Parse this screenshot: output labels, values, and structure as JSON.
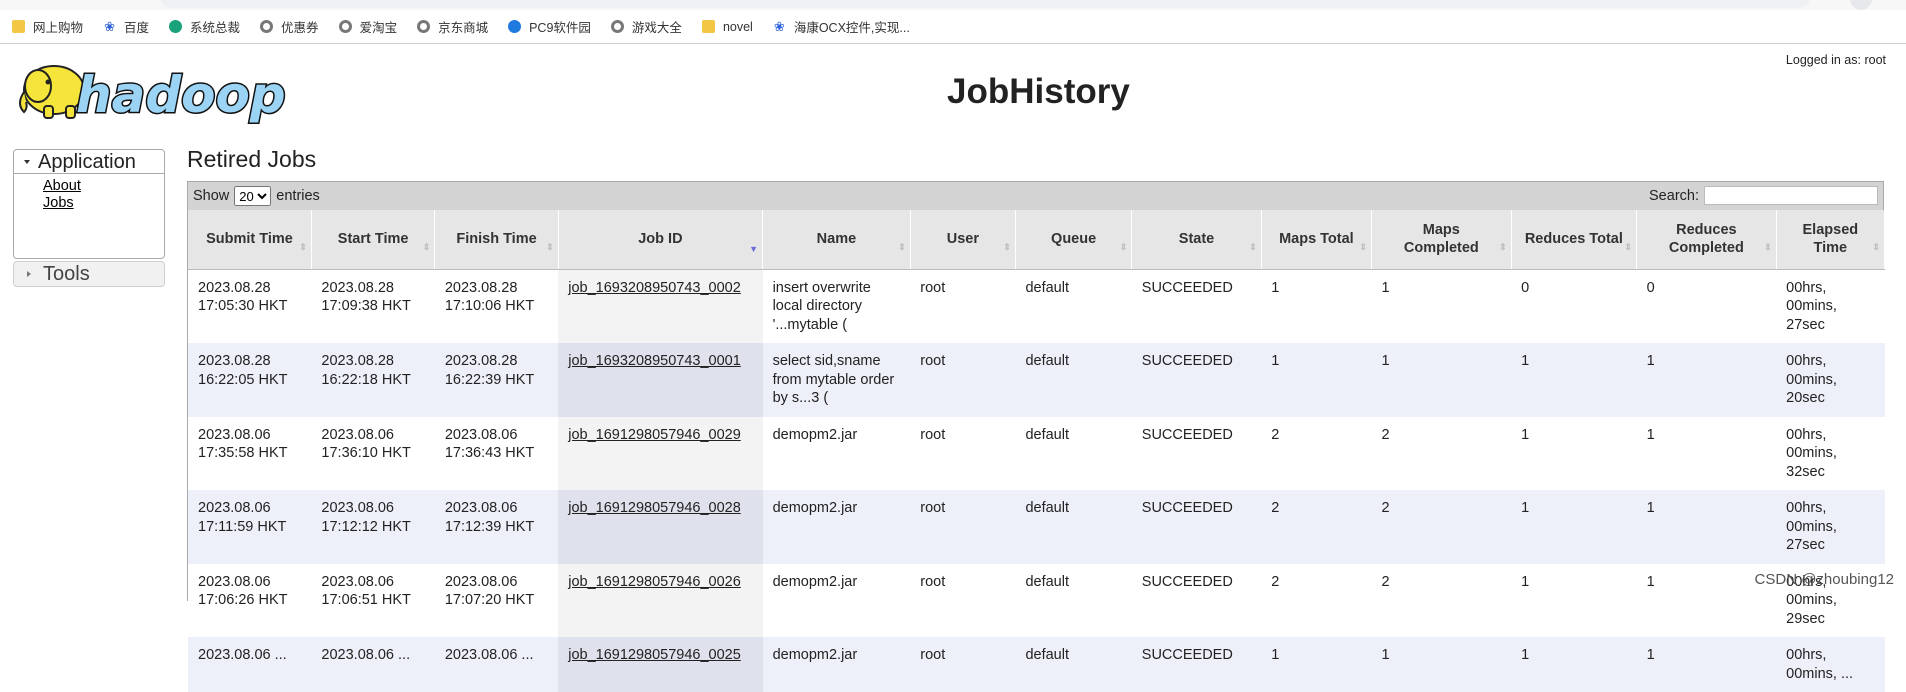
{
  "bookmarks": [
    {
      "label": "网上购物",
      "icon": "folder-icon"
    },
    {
      "label": "百度",
      "icon": "baidu-paw-icon"
    },
    {
      "label": "系统总裁",
      "icon": "e-browser-icon"
    },
    {
      "label": "优惠券",
      "icon": "globe-icon"
    },
    {
      "label": "爱淘宝",
      "icon": "globe-icon"
    },
    {
      "label": "京东商城",
      "icon": "globe-icon"
    },
    {
      "label": "PC9软件园",
      "icon": "pc9-icon"
    },
    {
      "label": "游戏大全",
      "icon": "globe-icon"
    },
    {
      "label": "novel",
      "icon": "folder-icon"
    },
    {
      "label": "海康OCX控件,实现...",
      "icon": "baidu-paw-icon"
    }
  ],
  "header": {
    "logo_text": "hadoop",
    "logged_in": "Logged in as: root",
    "title": "JobHistory"
  },
  "nav": {
    "application_label": "Application",
    "links": [
      "About",
      "Jobs"
    ],
    "tools_label": "Tools"
  },
  "main": {
    "section_title": "Retired Jobs",
    "show_label": "Show",
    "entries_value": "20",
    "entries_label": "entries",
    "search_label": "Search:"
  },
  "table": {
    "columns": [
      "Submit Time",
      "Start Time",
      "Finish Time",
      "Job ID",
      "Name",
      "User",
      "Queue",
      "State",
      "Maps Total",
      "Maps Completed",
      "Reduces Total",
      "Reduces Completed",
      "Elapsed Time"
    ],
    "sorted_column": "Job ID",
    "rows": [
      [
        "2023.08.28 17:05:30 HKT",
        "2023.08.28 17:09:38 HKT",
        "2023.08.28 17:10:06 HKT",
        "job_1693208950743_0002",
        "insert overwrite local directory '...mytable (",
        "root",
        "default",
        "SUCCEEDED",
        "1",
        "1",
        "0",
        "0",
        "00hrs, 00mins, 27sec"
      ],
      [
        "2023.08.28 16:22:05 HKT",
        "2023.08.28 16:22:18 HKT",
        "2023.08.28 16:22:39 HKT",
        "job_1693208950743_0001",
        "select sid,sname from mytable order by s...3 (",
        "root",
        "default",
        "SUCCEEDED",
        "1",
        "1",
        "1",
        "1",
        "00hrs, 00mins, 20sec"
      ],
      [
        "2023.08.06 17:35:58 HKT",
        "2023.08.06 17:36:10 HKT",
        "2023.08.06 17:36:43 HKT",
        "job_1691298057946_0029",
        "demopm2.jar",
        "root",
        "default",
        "SUCCEEDED",
        "2",
        "2",
        "1",
        "1",
        "00hrs, 00mins, 32sec"
      ],
      [
        "2023.08.06 17:11:59 HKT",
        "2023.08.06 17:12:12 HKT",
        "2023.08.06 17:12:39 HKT",
        "job_1691298057946_0028",
        "demopm2.jar",
        "root",
        "default",
        "SUCCEEDED",
        "2",
        "2",
        "1",
        "1",
        "00hrs, 00mins, 27sec"
      ],
      [
        "2023.08.06 17:06:26 HKT",
        "2023.08.06 17:06:51 HKT",
        "2023.08.06 17:07:20 HKT",
        "job_1691298057946_0026",
        "demopm2.jar",
        "root",
        "default",
        "SUCCEEDED",
        "2",
        "2",
        "1",
        "1",
        "00hrs, 00mins, 29sec"
      ],
      [
        "2023.08.06 ...",
        "2023.08.06 ...",
        "2023.08.06 ...",
        "job_1691298057946_0025",
        "demopm2.jar",
        "root",
        "default",
        "SUCCEEDED",
        "1",
        "1",
        "1",
        "1",
        "00hrs, 00mins, ..."
      ]
    ]
  },
  "watermark": "CSDN @zhoubing12"
}
